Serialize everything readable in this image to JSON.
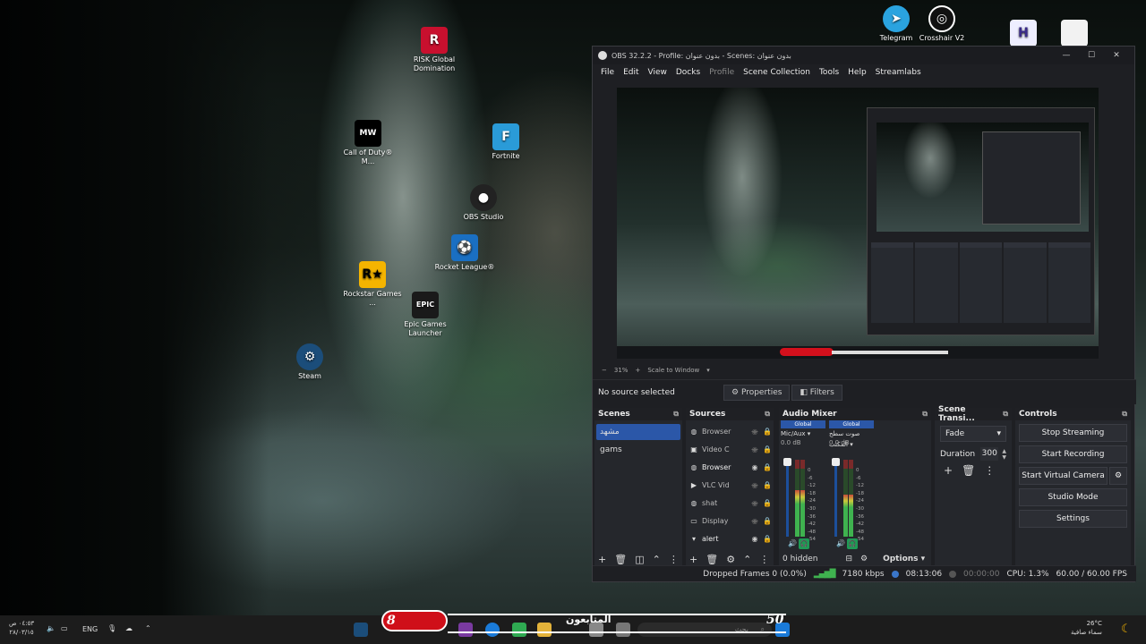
{
  "desktop": {
    "icons": {
      "risk": "RISK Global Domination",
      "cod": "Call of Duty® M...",
      "fortnite": "Fortnite",
      "obs": "OBS Studio",
      "rocket": "Rocket League®",
      "rockstar": "Rockstar Games ...",
      "epic": "Epic Games Launcher",
      "steam": "Steam",
      "telegram": "Telegram",
      "crosshair": "Crosshair V2"
    }
  },
  "obs": {
    "title": "OBS 32.2.2 - Profile: بدون عنوان - Scenes: بدون عنوان",
    "menu": [
      "File",
      "Edit",
      "View",
      "Docks",
      "Profile",
      "Scene Collection",
      "Tools",
      "Help",
      "Streamlabs"
    ],
    "zoom": "31%",
    "scale_mode": "Scale to Window",
    "no_source": "No source selected",
    "properties": "Properties",
    "filters": "Filters",
    "scenes": {
      "title": "Scenes",
      "items": [
        "مشهد",
        "gams"
      ]
    },
    "sources": {
      "title": "Sources",
      "items": [
        {
          "name": "Browser",
          "icon": "globe-icon"
        },
        {
          "name": "Video C",
          "icon": "camera-icon"
        },
        {
          "name": "Browser",
          "icon": "globe-icon"
        },
        {
          "name": "VLC Vid",
          "icon": "play-icon"
        },
        {
          "name": "shat",
          "icon": "globe-icon"
        },
        {
          "name": "Display",
          "icon": "monitor-icon"
        },
        {
          "name": "alert",
          "icon": "folder-icon"
        }
      ]
    },
    "mixer": {
      "title": "Audio Mixer",
      "global": "Global",
      "channels": [
        {
          "name": "Mic/Aux",
          "db": "0.0 dB",
          "level": 0.6
        },
        {
          "name": "صوت سطح المكتب",
          "db": "0.0 dB",
          "level": 0.55
        }
      ],
      "scale": [
        "0",
        "-6",
        "-12",
        "-18",
        "-24",
        "-30",
        "-36",
        "-42",
        "-48",
        "-54",
        "-60"
      ],
      "hidden": "0 hidden",
      "options": "Options"
    },
    "transitions": {
      "title": "Scene Transi...",
      "type": "Fade",
      "duration_label": "Duration",
      "duration_value": "300"
    },
    "controls": {
      "title": "Controls",
      "stop_streaming": "Stop Streaming",
      "start_recording": "Start Recording",
      "start_virtual_camera": "Start Virtual Camera",
      "studio_mode": "Studio Mode",
      "settings": "Settings"
    },
    "status": {
      "dropped": "Dropped Frames 0 (0.0%)",
      "kbps": "7180 kbps",
      "stream_time": "08:13:06",
      "rec_time": "00:00:00",
      "cpu": "CPU: 1.3%",
      "fps": "60.00 / 60.00 FPS"
    }
  },
  "taskbar": {
    "time": "٠٤:٥٣ ص",
    "date": "٢٨/٠٣/١٥",
    "lang": "ENG",
    "temp": "26°C",
    "weather": "سماء صافية",
    "search_placeholder": "بحث",
    "overlay_label": "المتابعون",
    "overlay_left": "8",
    "overlay_right": "50"
  },
  "colors": {
    "accent": "#2b57a8",
    "overlay_red": "#cf0f19",
    "meter_green": "#3fb24f"
  }
}
